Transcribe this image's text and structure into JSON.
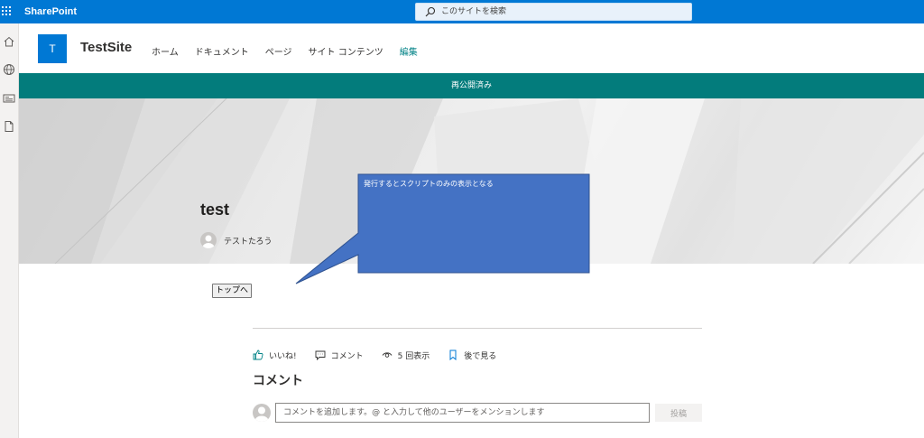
{
  "suite": {
    "brand": "SharePoint",
    "search_placeholder": "このサイトを検索"
  },
  "site": {
    "logo_letter": "T",
    "title": "TestSite",
    "nav": [
      {
        "label": "ホーム"
      },
      {
        "label": "ドキュメント"
      },
      {
        "label": "ページ"
      },
      {
        "label": "サイト コンテンツ"
      },
      {
        "label": "編集"
      }
    ]
  },
  "status_banner": "再公開済み",
  "page": {
    "title": "test",
    "author": "テストたろう",
    "top_button": "トップへ"
  },
  "callout": {
    "text": "発行するとスクリプトのみの表示となる",
    "fill": "#4472c4",
    "border": "#2f528f"
  },
  "actions": {
    "like": "いいね!",
    "comment": "コメント",
    "views": "5 回表示",
    "save": "後で見る"
  },
  "comments": {
    "heading": "コメント",
    "placeholder": "コメントを追加します。@ と入力して他のユーザーをメンションします",
    "post_button": "投稿"
  },
  "colors": {
    "suite_bar": "#0078d4",
    "accent_teal": "#037c7c",
    "nav_accent": "#038387"
  },
  "icons": {
    "appbar": [
      "home-icon",
      "globe-icon",
      "news-icon",
      "document-icon"
    ]
  }
}
